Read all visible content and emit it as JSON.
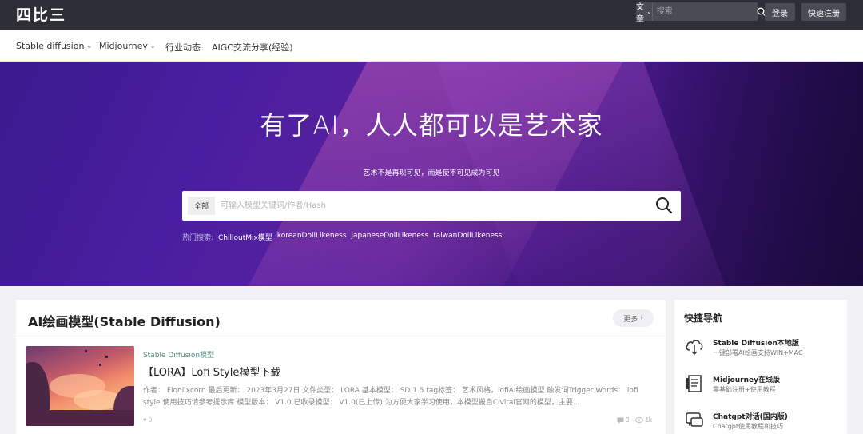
{
  "topbar": {
    "logo": "四比三",
    "search_type": "文章",
    "search_placeholder": "搜索",
    "login_label": "登录",
    "register_label": "快速注册"
  },
  "nav": {
    "items": [
      {
        "label": "Stable diffusion",
        "dropdown": true
      },
      {
        "label": "Midjourney",
        "dropdown": true
      },
      {
        "label": "行业动态",
        "dropdown": false
      },
      {
        "label": "AIGC交流分享(经验)",
        "dropdown": false
      }
    ]
  },
  "hero": {
    "title": "有了AI，人人都可以是艺术家",
    "subtitle": "艺术不是再现可见，而是使不可见成为可见",
    "scope_label": "全部",
    "search_placeholder": "可输入模型关键词/作者/Hash",
    "hot_label": "热门搜索:",
    "hot_tags": [
      "ChilloutMix模型",
      "koreanDollLikeness",
      "japaneseDollLikeness",
      "taiwanDollLikeness"
    ]
  },
  "main": {
    "section_title": "AI绘画模型(Stable Diffusion)",
    "more_label": "更多",
    "post": {
      "category": "Stable Diffusion模型",
      "title": "【LORA】Lofi Style模型下载",
      "excerpt": "作者： Flonlixcorn 最后更新： 2023年3月27日 文件类型： LORA 基本模型： SD 1.5 tag标签： 艺术风格，lofiAI绘画模型 触发词Trigger Words： lofi style 使用技巧请参考提示库 模型版本： V1.0 已收录模型： V1.0(已上传) 为方便大家学习使用，本模型搬自Civitai官网的模型，主要...",
      "likes": "0",
      "comments": "0",
      "views": "1k"
    }
  },
  "sidebar": {
    "title": "快捷导航",
    "items": [
      {
        "name": "Stable Diffusion本地版",
        "desc": "一键部署AI绘画支持WIN+MAC",
        "icon": "cloud-download-icon"
      },
      {
        "name": "Midjourney在线版",
        "desc": "零基础注册+使用教程",
        "icon": "document-icon"
      },
      {
        "name": "Chatgpt对话(国内版)",
        "desc": "Chatgpt使用教程和技巧",
        "icon": "chat-icon"
      }
    ]
  }
}
